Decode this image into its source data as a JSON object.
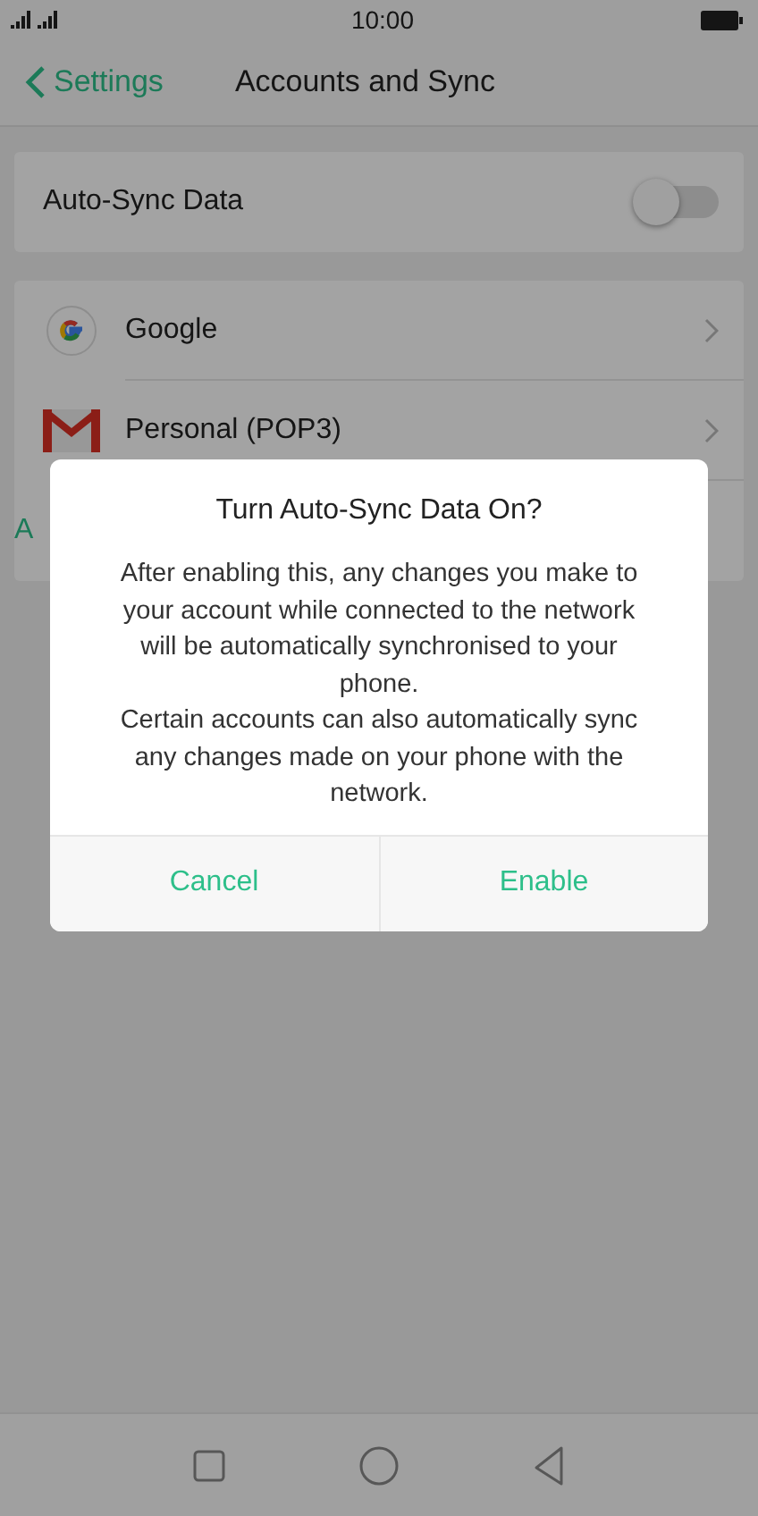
{
  "status_bar": {
    "time": "10:00"
  },
  "header": {
    "back": "Settings",
    "title": "Accounts and Sync"
  },
  "auto_sync": {
    "label": "Auto-Sync Data",
    "on": false
  },
  "accounts": [
    {
      "kind": "google",
      "label": "Google"
    },
    {
      "kind": "gmail",
      "label": "Personal (POP3)"
    },
    {
      "kind": "add",
      "label": "A"
    }
  ],
  "dialog": {
    "title": "Turn Auto-Sync Data On?",
    "message": "After enabling this, any changes you make to your account while connected to the network will be automatically synchronised to your phone.\nCertain accounts can also automatically sync any changes made on your phone with the network.",
    "buttons": [
      "Cancel",
      "Enable"
    ]
  }
}
